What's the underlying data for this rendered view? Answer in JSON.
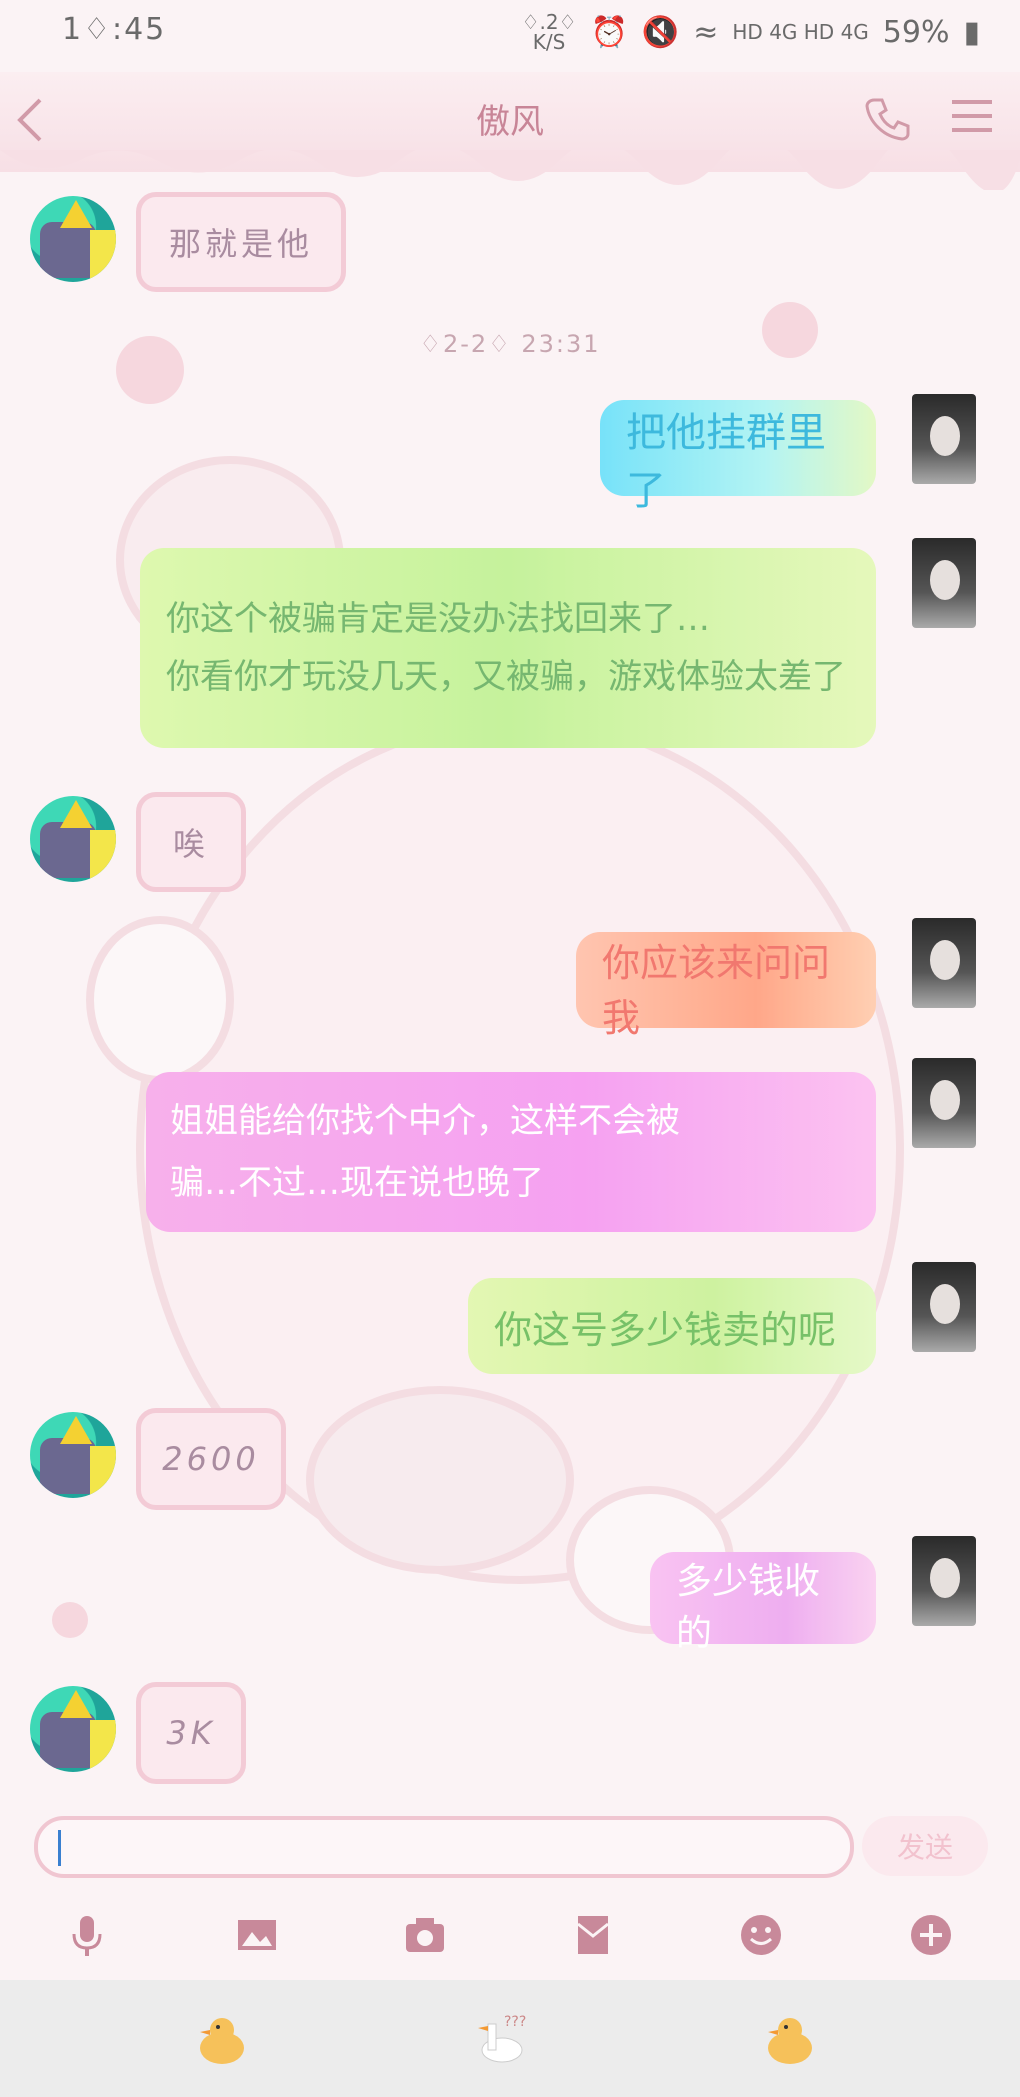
{
  "status_bar": {
    "time": "1♢:45",
    "speed": "♢.2♢",
    "speed_unit": "K/S",
    "network": "HD 4G HD 4G",
    "battery": "59%"
  },
  "header": {
    "title": "傲风"
  },
  "messages": [
    {
      "side": "left",
      "text": "那就是他"
    },
    {
      "side": "right",
      "text": "把他挂群里了"
    },
    {
      "side": "right",
      "text_lines": [
        "你这个被骗肯定是没办法找回来了…",
        "你看你才玩没几天，又被骗，游戏体验太",
        "差了"
      ]
    },
    {
      "side": "left",
      "text": "唉"
    },
    {
      "side": "right",
      "text": "你应该来问问我"
    },
    {
      "side": "right",
      "text_lines": [
        "姐姐能给你找个中介，这样不会被",
        "骗…不过…现在说也晚了"
      ]
    },
    {
      "side": "right",
      "text": "你这号多少钱卖的呢"
    },
    {
      "side": "left",
      "text": "2600"
    },
    {
      "side": "right",
      "text": "多少钱收的"
    },
    {
      "side": "left",
      "text": "3K"
    }
  ],
  "timestamp": "♢2-2♢ 23:31",
  "composer": {
    "send_label": "发送"
  },
  "colors": {
    "accent": "#c88597",
    "bubble_border": "#f3cbd6",
    "background": "#fbf3f5"
  },
  "icons": [
    "back-icon",
    "phone-icon",
    "menu-icon",
    "mic-icon",
    "image-icon",
    "camera-icon",
    "red-packet-icon",
    "emoji-icon",
    "plus-icon",
    "duck-icon"
  ]
}
